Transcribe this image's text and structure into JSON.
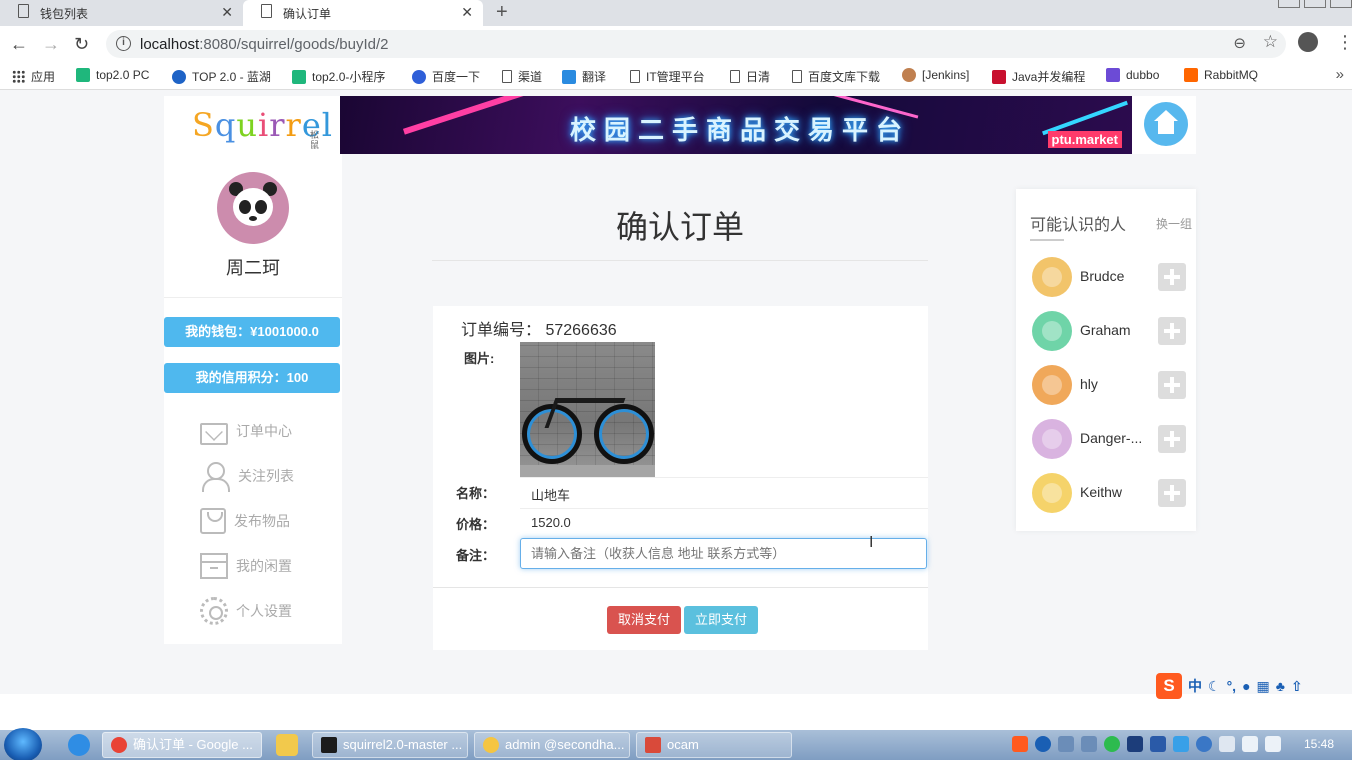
{
  "browser": {
    "tabs": [
      {
        "label": "钱包列表"
      },
      {
        "label": "确认订单"
      }
    ],
    "url_host": "localhost",
    "url_path": ":8080/squirrel/goods/buyId/2",
    "bookmarks": [
      {
        "label": "应用",
        "icon": "apps-grid-icon"
      },
      {
        "label": "top2.0 PC",
        "icon": "green-icon",
        "color": "#1fb77c"
      },
      {
        "label": "TOP 2.0 - 蓝湖",
        "icon": "lanhu-icon",
        "color": "#1e63c6"
      },
      {
        "label": "top2.0-小程序",
        "icon": "green-icon",
        "color": "#1fb77c"
      },
      {
        "label": "百度一下",
        "icon": "baidu-icon",
        "color": "#2f5fd8"
      },
      {
        "label": "渠道",
        "icon": "page-icon"
      },
      {
        "label": "翻译",
        "icon": "translate-icon",
        "color": "#2a8be0"
      },
      {
        "label": "IT管理平台",
        "icon": "page-icon"
      },
      {
        "label": "日清",
        "icon": "page-icon"
      },
      {
        "label": "百度文库下载",
        "icon": "page-icon"
      },
      {
        "label": "[Jenkins]",
        "icon": "jenkins-icon",
        "color": "#c08050"
      },
      {
        "label": "Java并发编程",
        "icon": "java-icon",
        "color": "#c8102e"
      },
      {
        "label": "dubbo",
        "icon": "dubbo-icon",
        "color": "#6c4bd6"
      },
      {
        "label": "RabbitMQ",
        "icon": "rabbitmq-icon",
        "color": "#ff6600"
      }
    ]
  },
  "header": {
    "logo_text": "Squirrel",
    "logo_sub": "松鼠",
    "banner_title": "校园二手商品交易平台",
    "banner_tag": "ptu.market"
  },
  "sidebar": {
    "username": "周二珂",
    "wallet": "我的钱包：¥1001000.0",
    "credit": "我的信用积分：100",
    "items": [
      {
        "label": "订单中心",
        "icon": "mail-icon"
      },
      {
        "label": "关注列表",
        "icon": "users-icon"
      },
      {
        "label": "发布物品",
        "icon": "bag-icon"
      },
      {
        "label": "我的闲置",
        "icon": "box-icon"
      },
      {
        "label": "个人设置",
        "icon": "gear-icon"
      }
    ]
  },
  "order": {
    "page_title": "确认订单",
    "order_no": "订单编号： 57266636",
    "image_label": "图片:",
    "name_label": "名称：",
    "name_value": "山地车",
    "price_label": "价格：",
    "price_value": "1520.0",
    "remark_label": "备注：",
    "remark_placeholder": "请输入备注（收获人信息 地址 联系方式等）",
    "cancel_label": "取消支付",
    "pay_label": "立即支付"
  },
  "friends": {
    "title": "可能认识的人",
    "switch_label": "换一组",
    "list": [
      {
        "name": "Brudce",
        "color": "#f2c46a"
      },
      {
        "name": "Graham",
        "color": "#6fd4a8"
      },
      {
        "name": "hly",
        "color": "#f0a85a"
      },
      {
        "name": "Danger-...",
        "color": "#d9b3e0"
      },
      {
        "name": "Keithw",
        "color": "#f5d36a"
      }
    ]
  },
  "ime": {
    "mode": "中"
  },
  "taskbar": {
    "tasks": [
      {
        "label": "确认订单 - Google ..."
      },
      {
        "label": "squirrel2.0-master ..."
      },
      {
        "label": "admin @secondha..."
      },
      {
        "label": "ocam"
      }
    ],
    "clock": "15:48"
  }
}
